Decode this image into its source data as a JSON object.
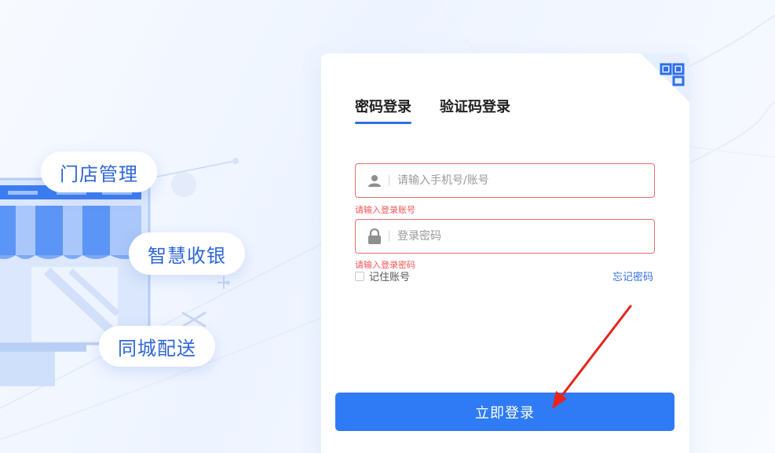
{
  "illustration": {
    "pills": [
      {
        "label": "门店管理"
      },
      {
        "label": "智慧收银"
      },
      {
        "label": "同城配送"
      }
    ]
  },
  "login": {
    "tabs": [
      {
        "label": "密码登录",
        "active": true
      },
      {
        "label": "验证码登录",
        "active": false
      }
    ],
    "account": {
      "value": "",
      "placeholder": "请输入手机号/账号",
      "error": "请输入登录账号",
      "icon": "user-icon"
    },
    "password": {
      "value": "",
      "placeholder": "登录密码",
      "error": "请输入登录密码",
      "icon": "lock-icon"
    },
    "remember_label": "记住账号",
    "forgot_label": "忘记密码",
    "submit_label": "立即登录",
    "qr_icon": "qr-code-icon"
  },
  "colors": {
    "accent": "#2f7bf5",
    "error": "#f25555",
    "pill_text": "#2f66d8",
    "annotation_arrow": "#e8231b"
  }
}
